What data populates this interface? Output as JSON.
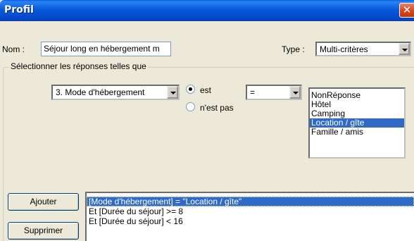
{
  "window": {
    "title": "Profil",
    "close_glyph": "✕"
  },
  "form": {
    "nom_label": "Nom :",
    "nom_value": "Séjour long en hébergement m",
    "type_label": "Type :",
    "type_value": "Multi-critères"
  },
  "selection": {
    "group_label": "Sélectionner les réponses telles que",
    "question_value": "3. Mode d'hébergement",
    "radio_est": "est",
    "radio_nest_pas": "n'est pas",
    "radio_selected": "est",
    "operator_value": "=",
    "answers": [
      {
        "label": "NonRéponse",
        "selected": false
      },
      {
        "label": "Hôtel",
        "selected": false
      },
      {
        "label": "Camping",
        "selected": false
      },
      {
        "label": "Location / gîte",
        "selected": true
      },
      {
        "label": "Famille / amis",
        "selected": false
      }
    ]
  },
  "buttons": {
    "ajouter": "Ajouter",
    "supprimer": "Supprimer"
  },
  "conditions": [
    {
      "text": "[Mode d'hébergement] = \"Location / gîte\"",
      "selected": true
    },
    {
      "text": "Et [Durée du séjour] >= 8",
      "selected": false
    },
    {
      "text": "Et [Durée du séjour] < 16",
      "selected": false
    }
  ],
  "colors": {
    "selection": "#316ac5",
    "titlebar": "#0054e3",
    "dialog_bg": "#ece9d8"
  }
}
